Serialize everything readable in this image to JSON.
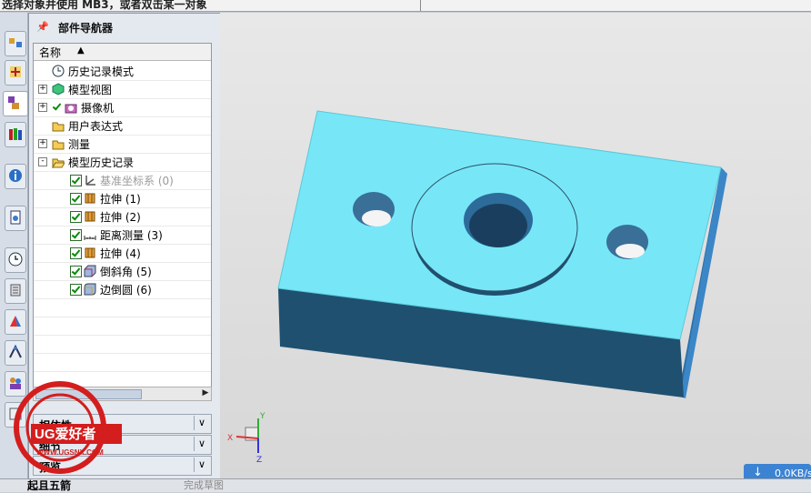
{
  "status": {
    "prompt": "选择对象并使用 MB3，或者双击某一对象"
  },
  "navigator": {
    "title": "部件导航器",
    "column_header": "名称",
    "items": [
      {
        "label": "历史记录模式",
        "icon": "clock-icon",
        "expand": ""
      },
      {
        "label": "模型视图",
        "icon": "model-view-icon",
        "expand": "+"
      },
      {
        "label": "摄像机",
        "icon": "camera-icon",
        "expand": "+"
      },
      {
        "label": "用户表达式",
        "icon": "folder-icon",
        "expand": ""
      },
      {
        "label": "测量",
        "icon": "folder-icon",
        "expand": "+"
      },
      {
        "label": "模型历史记录",
        "icon": "folder-open-icon",
        "expand": "-"
      }
    ],
    "features": [
      {
        "label": "基准坐标系 (0)",
        "icon": "datum-csys-icon",
        "dim": true
      },
      {
        "label": "拉伸 (1)",
        "icon": "extrude-icon",
        "dim": false
      },
      {
        "label": "拉伸 (2)",
        "icon": "extrude-icon",
        "dim": false
      },
      {
        "label": "距离测量 (3)",
        "icon": "measure-distance-icon",
        "dim": false
      },
      {
        "label": "拉伸 (4)",
        "icon": "extrude-icon",
        "dim": false
      },
      {
        "label": "倒斜角 (5)",
        "icon": "chamfer-icon",
        "dim": false
      },
      {
        "label": "边倒圆 (6)",
        "icon": "edge-blend-icon",
        "dim": false
      }
    ],
    "panels": [
      "相依性",
      "细节",
      "预览"
    ]
  },
  "bottom_toolbar": {
    "left_label": "起且五箭",
    "mid_label": "完成草图"
  },
  "network": {
    "speed": "0.0KB/s"
  },
  "watermark": {
    "brand": "UG爱好者",
    "url": "WWW.UGSNX.COM"
  },
  "triad": {
    "x": "X",
    "y": "Y",
    "z": "Z"
  },
  "colors": {
    "part_top": "#77e7f7",
    "part_front": "#1f5070",
    "part_side": "#3b86c6",
    "accent": "#3c83d3"
  }
}
